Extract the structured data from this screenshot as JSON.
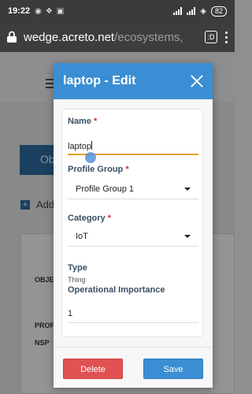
{
  "status_bar": {
    "time": "19:22",
    "notification_icons": [
      "headset-icon",
      "dropbox-icon",
      "bag-icon"
    ],
    "battery": "82"
  },
  "browser": {
    "url_host": "wedge.acreto.net",
    "url_path": "/ecosystems,",
    "tab_count": ":D"
  },
  "background_page": {
    "primary_button_label": "Ob",
    "add_link_label": "Add",
    "row_labels": [
      "OBJEC",
      "PROFI",
      "NSP"
    ]
  },
  "modal": {
    "title": "laptop - Edit",
    "fields": {
      "name": {
        "label": "Name",
        "required_mark": "*",
        "value": "laptop"
      },
      "profile_group": {
        "label": "Profile Group",
        "required_mark": "*",
        "value": "Profile Group 1"
      },
      "category": {
        "label": "Category",
        "required_mark": "*",
        "value": "IoT"
      },
      "type": {
        "label": "Type",
        "value": "Thing"
      },
      "operational_importance": {
        "label": "Operational Importance",
        "value": "1"
      }
    },
    "buttons": {
      "delete": "Delete",
      "save": "Save"
    }
  },
  "colors": {
    "header_blue": "#3b8ed3",
    "delete_red": "#e05252",
    "focus_underline": "#e3a12a",
    "required": "#d03030"
  }
}
